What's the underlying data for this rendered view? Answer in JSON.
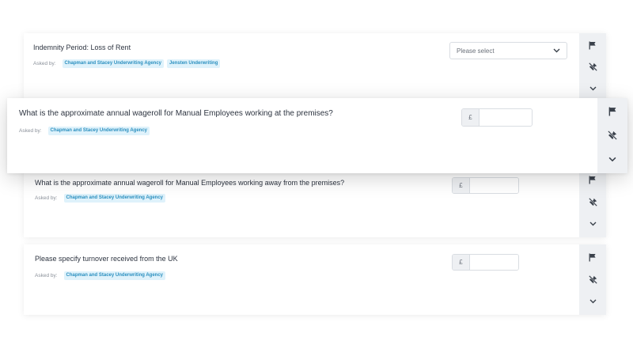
{
  "cards": [
    {
      "question": "Indemnity Period: Loss of Rent",
      "asked_by_label": "Asked by:",
      "askers": [
        "Chapman and Stacey Underwriting Agency",
        "Jensten Underwriting"
      ],
      "select_placeholder": "Please select"
    },
    {
      "question": "What is the approximate annual wageroll for Manual Employees working at the premises?",
      "asked_by_label": "Asked by:",
      "askers": [
        "Chapman and Stacey Underwriting Agency"
      ],
      "currency": "£",
      "value": ""
    },
    {
      "question": "What is the approximate annual wageroll for Manual Employees working away from the premises?",
      "asked_by_label": "Asked by:",
      "askers": [
        "Chapman and Stacey Underwriting Agency"
      ],
      "currency": "£",
      "value": ""
    },
    {
      "question": "Please specify turnover received from the UK",
      "asked_by_label": "Asked by:",
      "askers": [
        "Chapman and Stacey Underwriting Agency"
      ],
      "currency": "£",
      "value": ""
    }
  ],
  "icons": {
    "flag": "flag-icon",
    "pin_off": "unpin-icon",
    "expand": "chevron-down-icon"
  },
  "colors": {
    "tag_bg": "#dff2fb",
    "tag_text": "#2a8fbf",
    "rail_bg": "#eef0f3"
  }
}
